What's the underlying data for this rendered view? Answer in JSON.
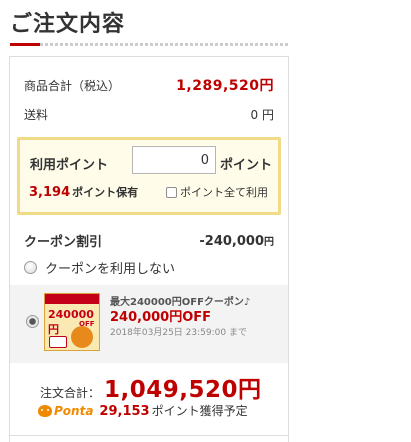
{
  "header": {
    "title": "ご注文内容"
  },
  "summary": {
    "subtotal_label": "商品合計（税込）",
    "subtotal_value": "1,289,520円",
    "shipping_label": "送料",
    "shipping_value": "0 円"
  },
  "points": {
    "label": "利用ポイント",
    "input_value": "0",
    "unit": "ポイント",
    "owned_value": "3,194",
    "owned_suffix": "ポイント保有",
    "use_all_label": "ポイント全て利用",
    "use_all_checked": false
  },
  "coupon": {
    "label": "クーポン割引",
    "value": "-240,000",
    "value_unit": "円",
    "no_coupon_label": "クーポンを利用しない",
    "selected_option": "coupon",
    "card": {
      "image_title": "240000円",
      "image_off": "OFF",
      "name": "最大240000円OFFクーポン♪",
      "amount": "240,000円OFF",
      "expiry": "2018年03月25日 23:59:00 まで"
    }
  },
  "total": {
    "label": "注文合計：",
    "value": "1,049,520円"
  },
  "ponta": {
    "logo_text": "Ponta",
    "points_value": "29,153",
    "points_suffix": "ポイント獲得予定"
  },
  "colors": {
    "accent_red": "#bf0000",
    "point_box_border": "#f1db86",
    "point_box_bg": "#fffdea",
    "ponta_orange": "#f08a00"
  }
}
